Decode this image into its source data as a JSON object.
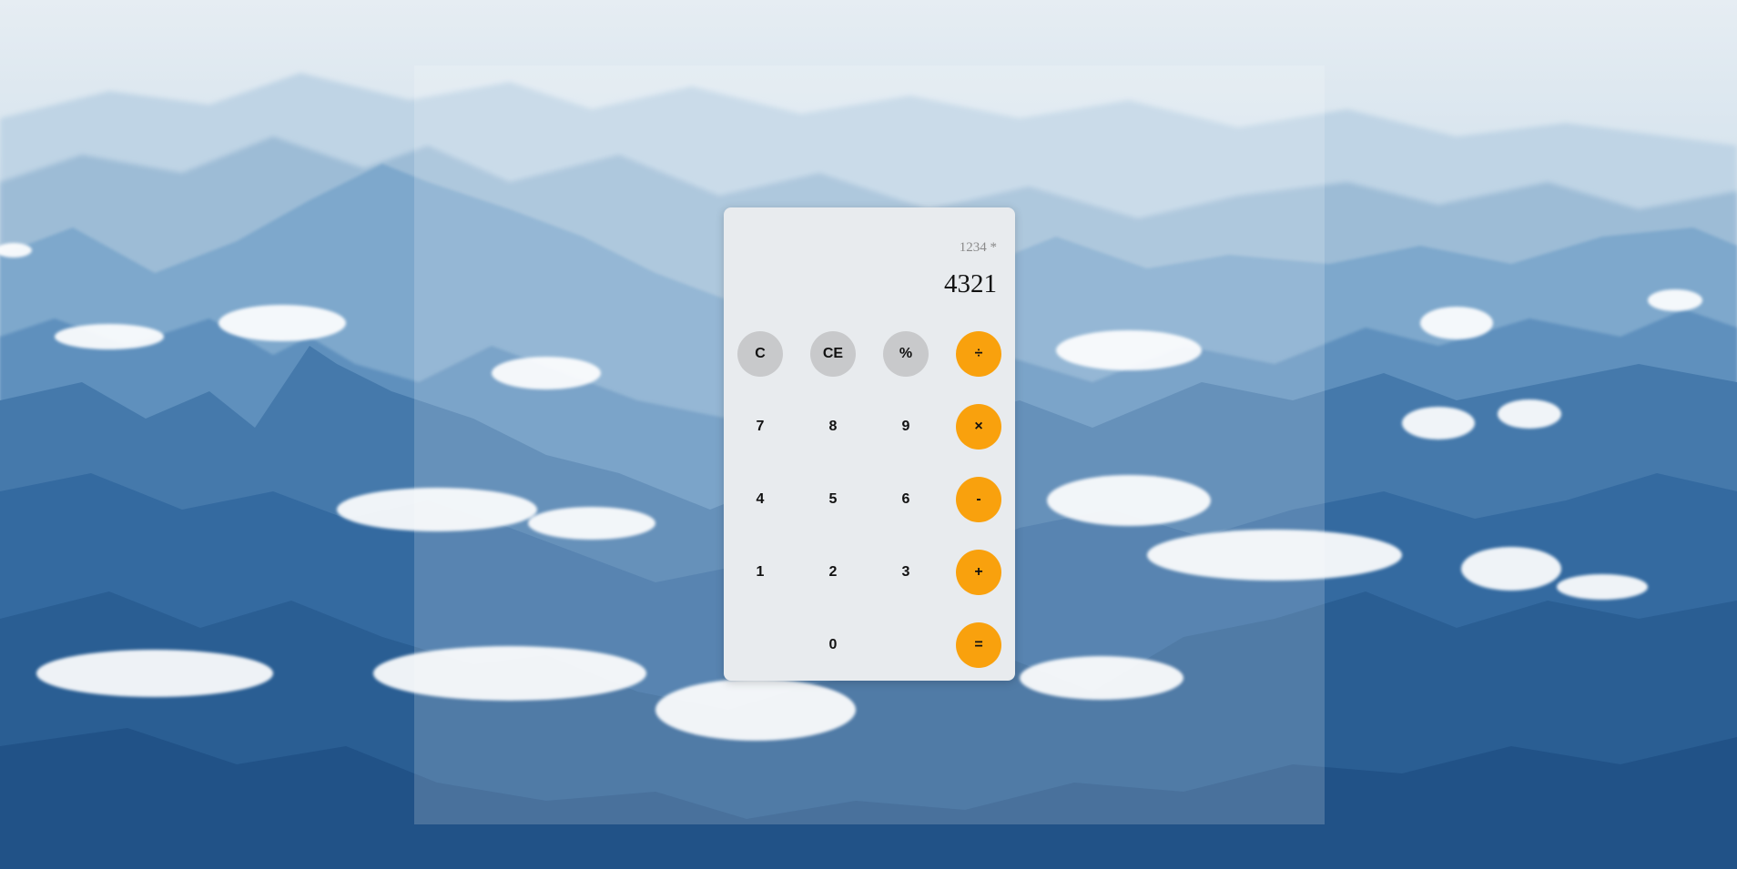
{
  "background": {
    "image": "mountain-range-above-clouds",
    "sky_color": "#e4ecf2",
    "mountain_color": "#2c6aa3"
  },
  "calculator": {
    "expression": "1234 *",
    "value": "4321",
    "keys": {
      "clear": "C",
      "clear_entry": "CE",
      "percent": "%",
      "divide": "÷",
      "seven": "7",
      "eight": "8",
      "nine": "9",
      "multiply": "×",
      "four": "4",
      "five": "5",
      "six": "6",
      "subtract": "-",
      "one": "1",
      "two": "2",
      "three": "3",
      "add": "+",
      "zero": "0",
      "equals": "="
    },
    "colors": {
      "body": "#e8ebee",
      "function_key": "#c8c9cb",
      "operator_key": "#f9a10d"
    }
  }
}
